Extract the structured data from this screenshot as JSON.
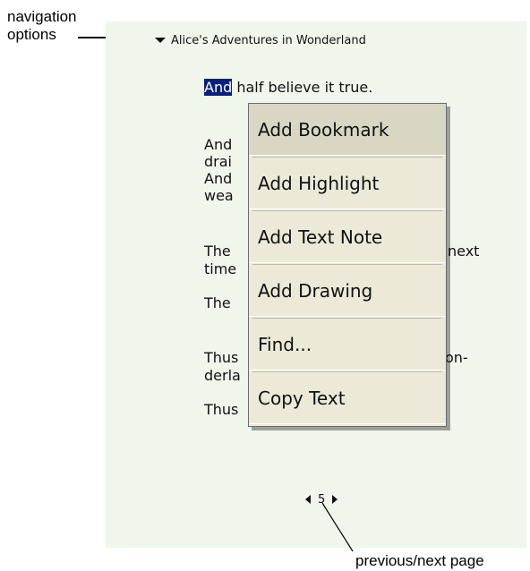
{
  "annotations": {
    "nav_line1": "navigation",
    "nav_line2": "options",
    "page_callout": "previous/next page"
  },
  "reader": {
    "book_title": "Alice's Adventures in Wonderland",
    "line1_selected": "And",
    "line1_rest": " half believe it true.",
    "paragraph1": [
      "And",
      "drai",
      "And",
      "wea",
      "The",
      "time",
      "The"
    ],
    "paragraph1_overflow": "next",
    "paragraph2": [
      "Thus",
      "derla",
      "Thus"
    ],
    "paragraph2_overflow": "on-",
    "page_number": "5"
  },
  "context_menu": {
    "items": [
      {
        "label": "Add Bookmark"
      },
      {
        "label": "Add Highlight"
      },
      {
        "label": "Add Text Note"
      },
      {
        "label": "Add Drawing"
      },
      {
        "label": "Find..."
      },
      {
        "label": "Copy Text"
      }
    ]
  },
  "colors": {
    "screen_bg": "#f1f6ed",
    "selection_bg": "#07207f",
    "menu_bg": "#ece9d8"
  }
}
